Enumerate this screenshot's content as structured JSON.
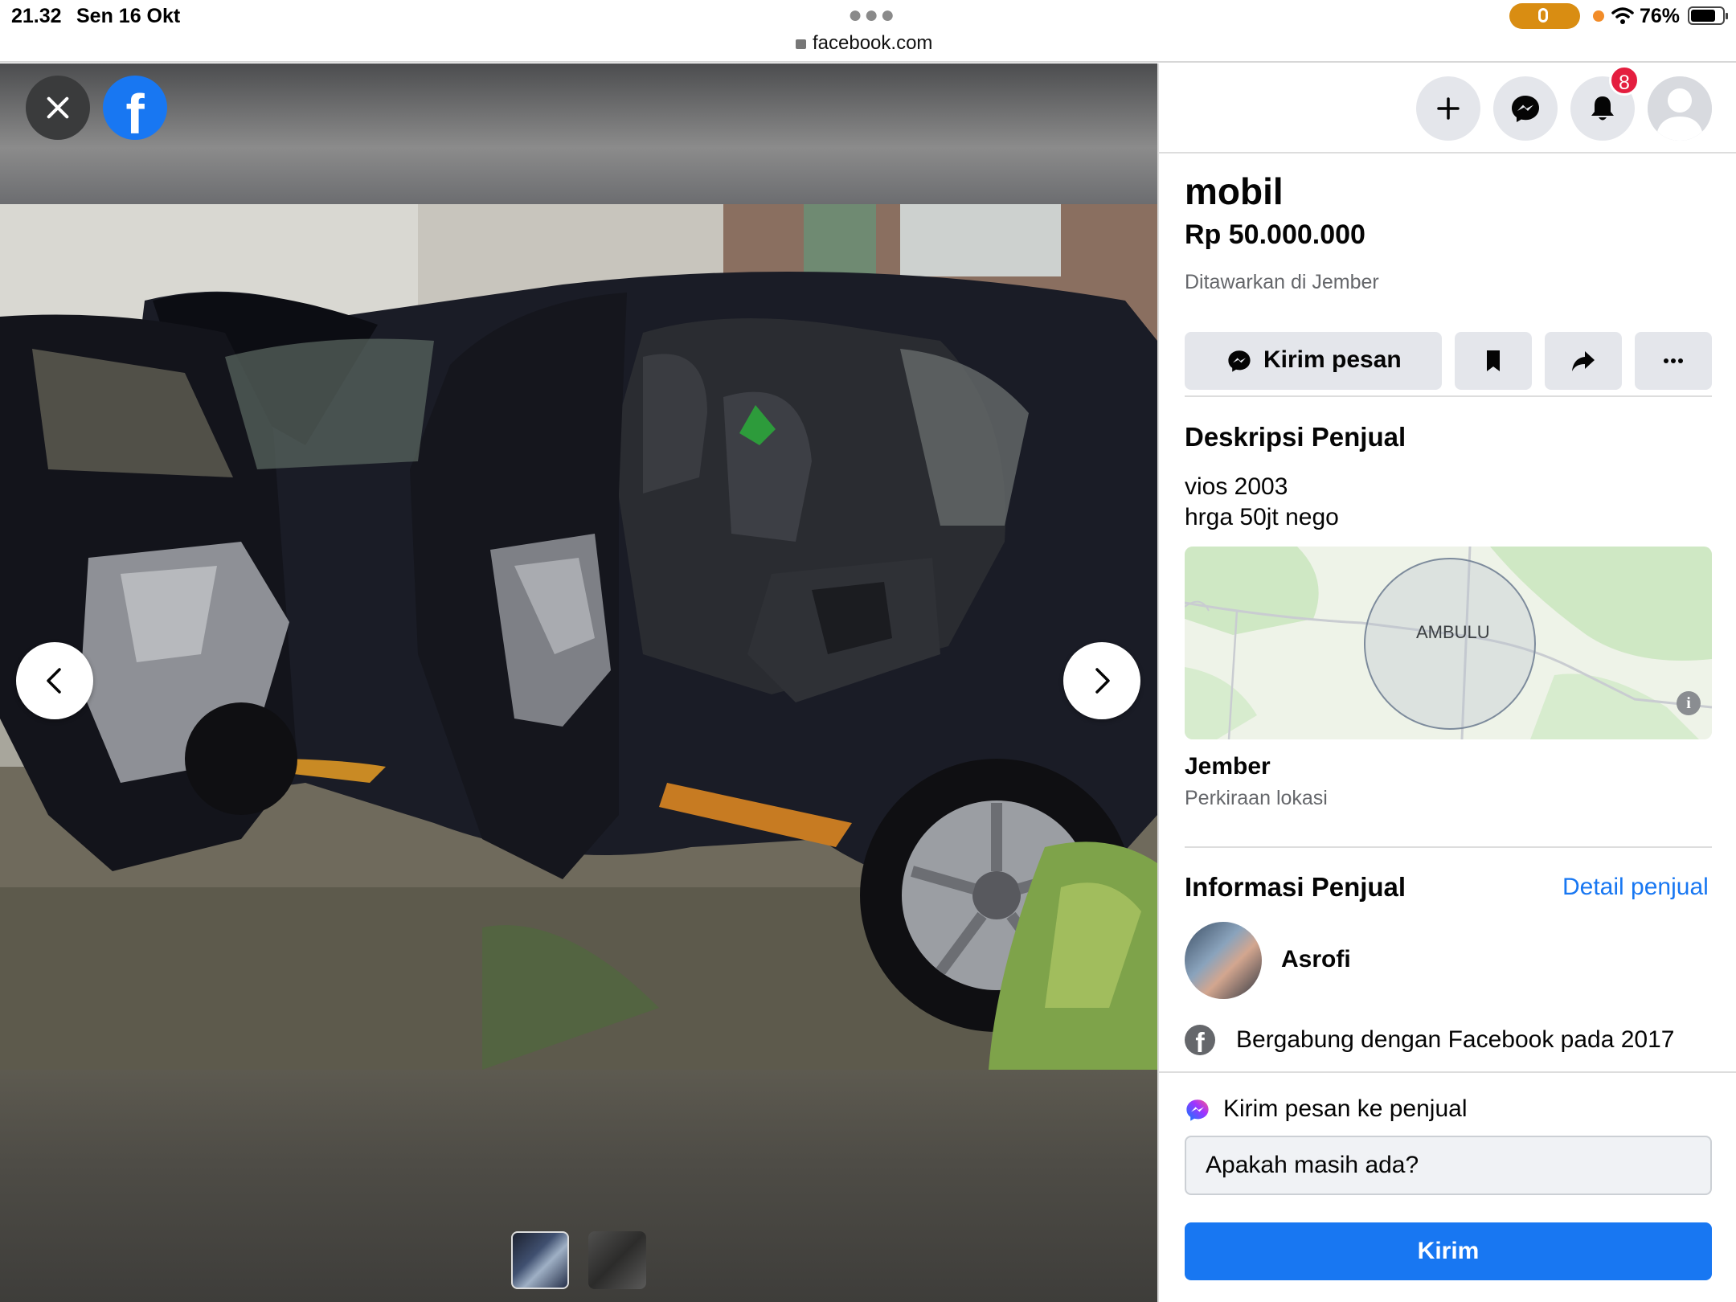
{
  "status_bar": {
    "time": "21.32",
    "date": "Sen 16 Okt",
    "url": "facebook.com",
    "battery": "76%"
  },
  "viewer": {
    "close_icon": "close-icon",
    "logo_icon": "facebook-logo",
    "logo_letter": "f",
    "prev_icon": "chevron-left-icon",
    "next_icon": "chevron-right-icon",
    "thumbnails": 2,
    "active_thumbnail": 1
  },
  "topbar": {
    "notifications_count": "8",
    "icons": [
      "plus-icon",
      "messenger-icon",
      "bell-icon",
      "avatar"
    ]
  },
  "listing": {
    "title": "mobil",
    "price": "Rp 50.000.000",
    "location": "Ditawarkan di Jember",
    "actions": {
      "message_label": "Kirim pesan",
      "save_icon": "bookmark-icon",
      "share_icon": "share-icon",
      "more_icon": "more-icon"
    },
    "description_heading": "Deskripsi Penjual",
    "description_lines": [
      "vios 2003",
      "hrga 50jt nego"
    ],
    "map_label": "AMBULU",
    "city": "Jember",
    "city_note": "Perkiraan lokasi"
  },
  "seller": {
    "heading": "Informasi Penjual",
    "details_link": "Detail penjual",
    "name": "Asrofi",
    "joined": "Bergabung dengan Facebook pada 2017"
  },
  "message_box": {
    "heading": "Kirim pesan ke penjual",
    "input_value": "Apakah masih ada?",
    "send_label": "Kirim"
  },
  "colors": {
    "brand": "#1877f2",
    "badge": "#e41e3f",
    "secondary_button": "#e4e6eb",
    "mic_pill": "#d98d12"
  }
}
